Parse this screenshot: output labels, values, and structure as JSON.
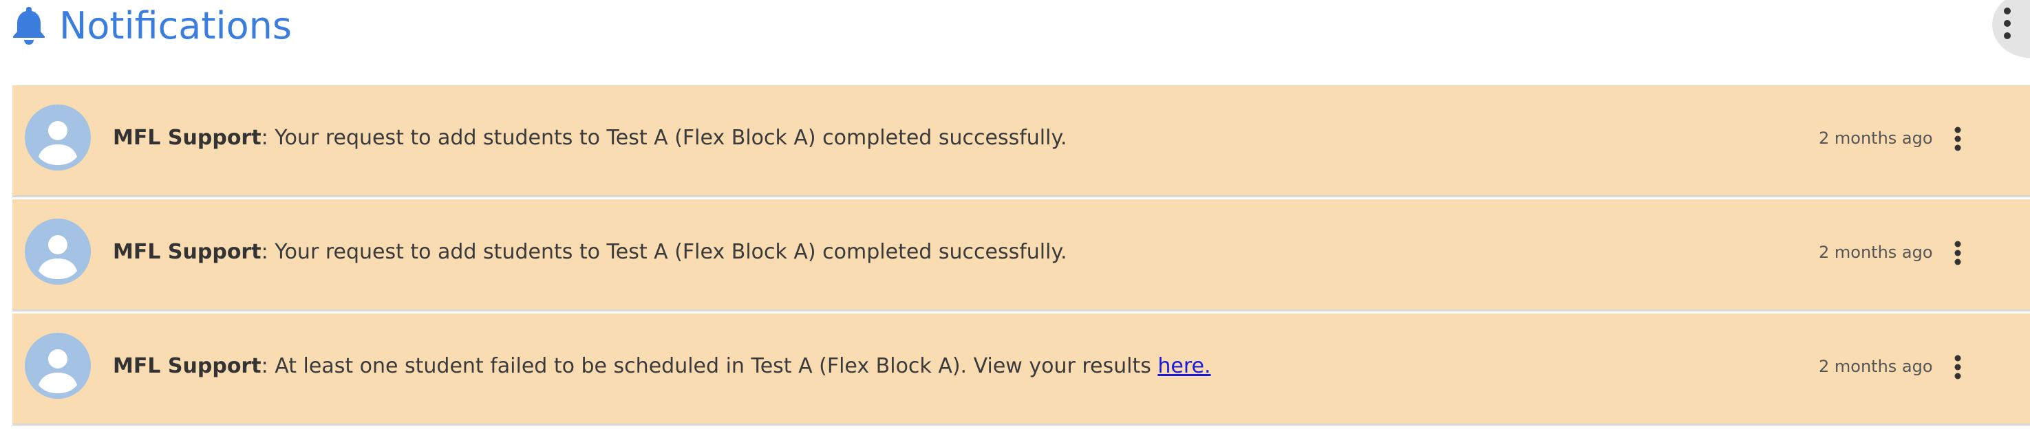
{
  "header": {
    "title": "Notifications",
    "icon": "bell-icon",
    "accent_color": "#3b7ddd"
  },
  "notifications": [
    {
      "sender": "MFL Support",
      "separator": ": ",
      "message": "Your request to add students to Test A (Flex Block A) completed successfully.",
      "link_text": "",
      "time": "2 months ago"
    },
    {
      "sender": "MFL Support",
      "separator": ": ",
      "message": "Your request to add students to Test A (Flex Block A) completed successfully.",
      "link_text": "",
      "time": "2 months ago"
    },
    {
      "sender": "MFL Support",
      "separator": ": ",
      "message": "At least one student failed to be scheduled in Test A (Flex Block A). View your results ",
      "link_text": "here.",
      "time": "2 months ago"
    }
  ],
  "colors": {
    "unread_background": "#f9dcb2",
    "avatar": "#a4c2e3"
  }
}
